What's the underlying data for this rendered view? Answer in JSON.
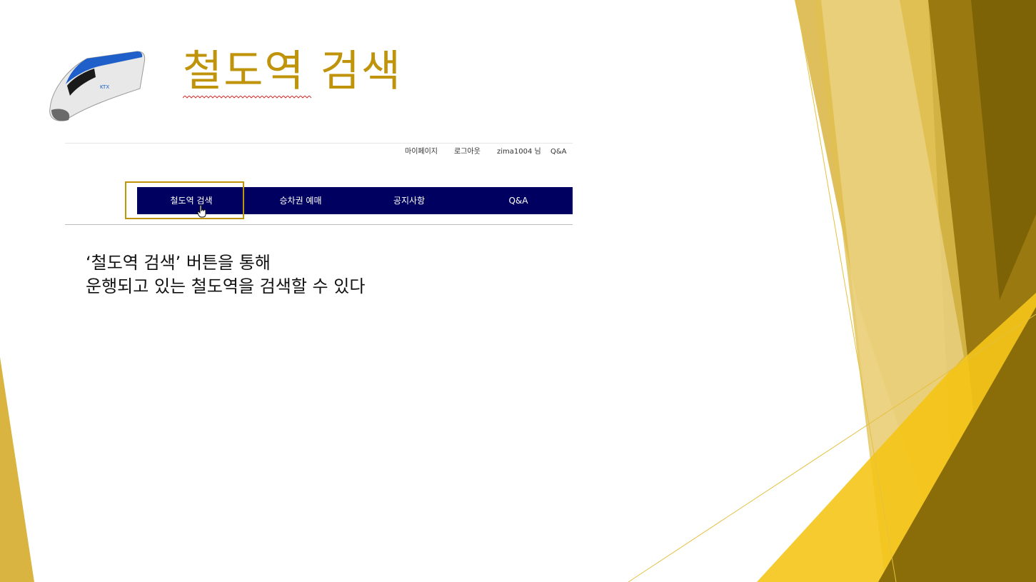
{
  "slide_title": "철도역 검색",
  "header": {
    "links": [
      "마이페이지",
      "로그아웃",
      "zima1004 님",
      "Q&A"
    ]
  },
  "nav": {
    "items": [
      "철도역 검색",
      "승차권 예매",
      "공지사항",
      "Q&A"
    ]
  },
  "description": {
    "line1": "‘철도역 검색’ 버튼을 통해",
    "line2": "운행되고 있는 철도역을 검색할 수 있다"
  },
  "colors": {
    "accent": "#c0940a",
    "nav_bg": "#000060"
  },
  "icons": [
    "ktx-train-logo",
    "hand-pointer-icon"
  ]
}
